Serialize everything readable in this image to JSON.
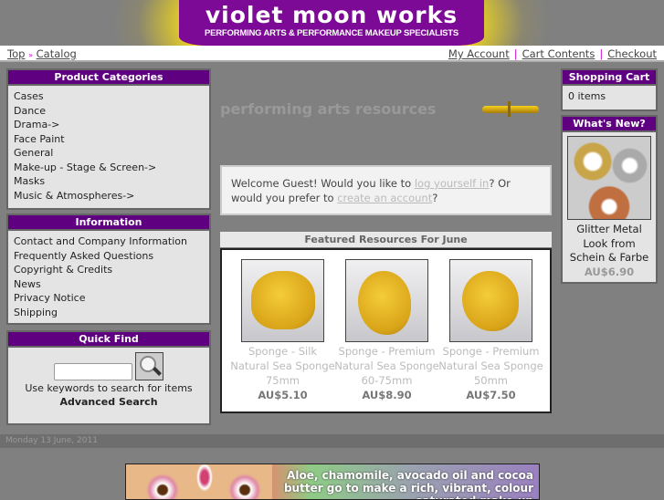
{
  "header": {
    "title": "violet moon works",
    "subtitle": "PERFORMING ARTS & PERFORMANCE MAKEUP SPECIALISTS"
  },
  "breadcrumb": {
    "items": [
      "Top",
      "Catalog"
    ],
    "separator": "»"
  },
  "top_links": [
    "My Account",
    "Cart Contents",
    "Checkout"
  ],
  "categories": {
    "title": "Product Categories",
    "items": [
      "Cases",
      "Dance",
      "Drama->",
      "Face Paint",
      "General",
      "Make-up - Stage & Screen->",
      "Masks",
      "Music & Atmospheres->"
    ]
  },
  "information": {
    "title": "Information",
    "items": [
      "Contact and Company Information",
      "Frequently Asked Questions",
      "Copyright & Credits",
      "News",
      "Privacy Notice",
      "Shipping"
    ]
  },
  "quick_find": {
    "title": "Quick Find",
    "value": "",
    "hint": "Use keywords to search for items",
    "advanced": "Advanced Search"
  },
  "center": {
    "title": "performing arts resources",
    "welcome_pre": "Welcome Guest! Would you like to ",
    "login_link": "log yourself in",
    "welcome_mid": "? Or would you prefer to ",
    "create_link": "create an account",
    "welcome_end": "?"
  },
  "featured": {
    "title": "Featured Resources For June",
    "products": [
      {
        "name": "Sponge - Silk Natural Sea Sponge 75mm",
        "price": "AU$5.10"
      },
      {
        "name": "Sponge - Premium Natural Sea Sponge 60-75mm",
        "price": "AU$8.90"
      },
      {
        "name": "Sponge - Premium Natural Sea Sponge 50mm",
        "price": "AU$7.50"
      }
    ]
  },
  "cart": {
    "title": "Shopping Cart",
    "contents": "0 items"
  },
  "whats_new": {
    "title": "What's New?",
    "name": "Glitter Metal Look from Schein & Farbe",
    "price": "AU$6.90"
  },
  "footer": {
    "date": "Monday 13 June, 2011",
    "ad_text": "Aloe, chamomile, avocado oil and cocoa butter go to make a rich, vibrant, colour saturated make-up"
  },
  "colors": {
    "brand": "#7d0a96",
    "box_header": "#5e0080",
    "background": "#808080"
  }
}
